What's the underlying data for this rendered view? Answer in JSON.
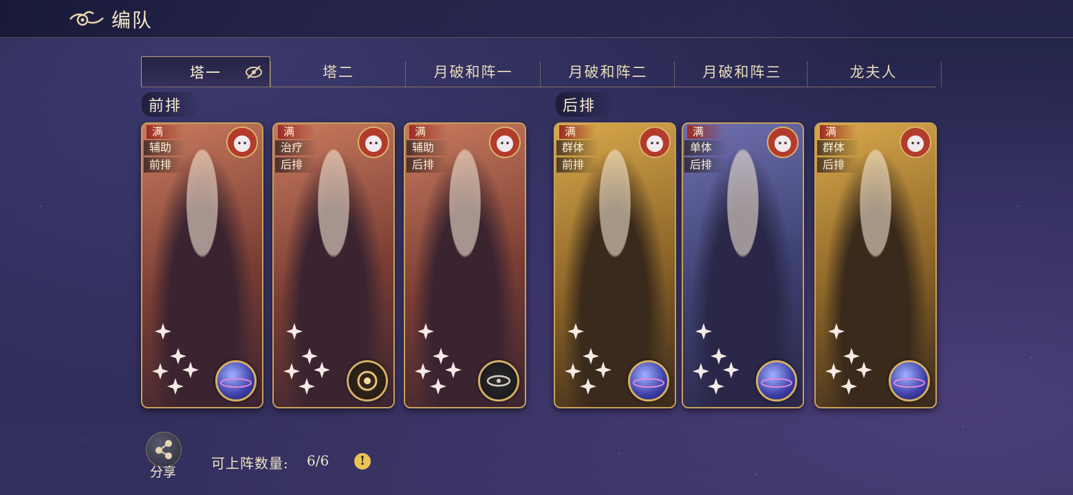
{
  "header": {
    "title": "编队",
    "back_icon": "cloud-back-icon"
  },
  "tabs": [
    {
      "label": "塔一",
      "active": true
    },
    {
      "label": "塔二",
      "active": false
    },
    {
      "label": "月破和阵一",
      "active": false
    },
    {
      "label": "月破和阵二",
      "active": false
    },
    {
      "label": "月破和阵三",
      "active": false
    },
    {
      "label": "龙夫人",
      "active": false
    }
  ],
  "sections": {
    "front": "前排",
    "back": "后排"
  },
  "cards": [
    {
      "full": "满",
      "role": "辅助",
      "position": "前排",
      "class_icon": "pig-icon",
      "element_icon": "planet-orb-icon",
      "stars": 5,
      "theme": "rose"
    },
    {
      "full": "满",
      "role": "治疗",
      "position": "后排",
      "class_icon": "sheep-icon",
      "element_icon": "sun-moon-icon",
      "stars": 5,
      "theme": "rose"
    },
    {
      "full": "满",
      "role": "辅助",
      "position": "后排",
      "class_icon": "sheep-icon",
      "element_icon": "dark-eye-icon",
      "stars": 5,
      "theme": "rose"
    },
    {
      "full": "满",
      "role": "群体",
      "position": "前排",
      "class_icon": "rooster-icon",
      "element_icon": "planet-orb-icon",
      "stars": 5,
      "theme": "gold"
    },
    {
      "full": "满",
      "role": "单体",
      "position": "后排",
      "class_icon": "sheep-icon",
      "element_icon": "planet-orb-icon",
      "stars": 5,
      "theme": "blue"
    },
    {
      "full": "满",
      "role": "群体",
      "position": "后排",
      "class_icon": "dragon-icon",
      "element_icon": "planet-orb-icon",
      "stars": 5,
      "theme": "gold"
    }
  ],
  "footer": {
    "share_label": "分享",
    "slots_label": "可上阵数量:",
    "slots_value": "6/6",
    "info_icon": "!"
  },
  "colors": {
    "accent_gold": "#c9a25a",
    "badge_red": "#9b2d24",
    "info_yellow": "#e9c455"
  }
}
